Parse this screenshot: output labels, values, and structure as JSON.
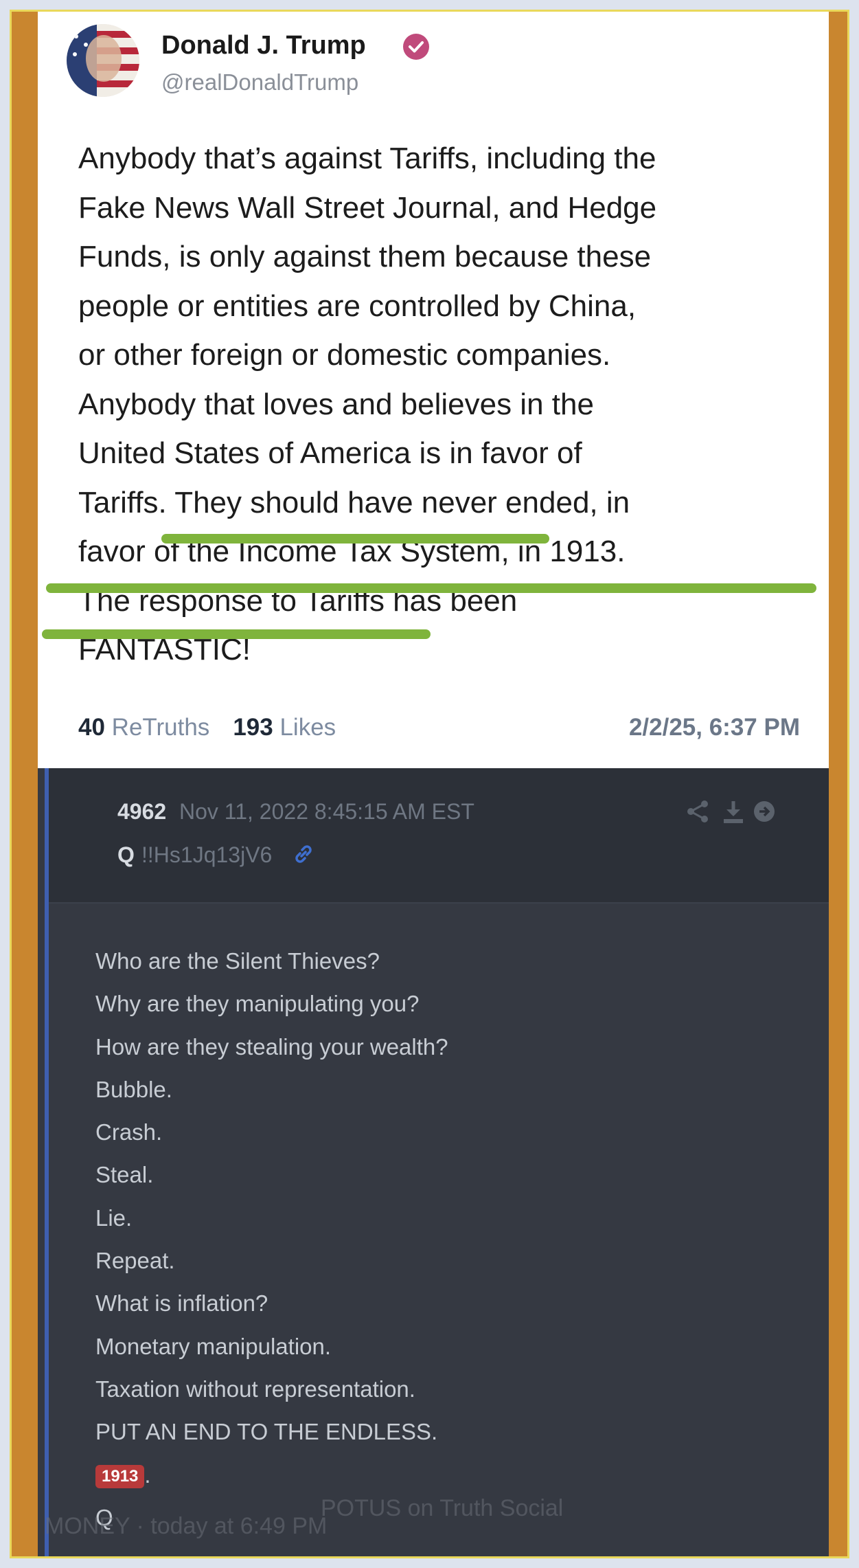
{
  "truth_post": {
    "author_name": "Donald J. Trump",
    "handle": "@realDonaldTrump",
    "body_lines": [
      "Anybody that’s against Tariffs, including the",
      "Fake News Wall Street Journal, and Hedge",
      "Funds, is only against them because these",
      "people or entities are controlled by China,",
      "or other foreign or domestic companies.",
      "Anybody that loves and believes in the",
      "United States of America is in favor of",
      "Tariffs. They should have never ended, in",
      "favor of the Income Tax System, in 1913.",
      "The response to Tariffs has been",
      "FANTASTIC!"
    ],
    "retruths_count": "40",
    "retruths_label": "ReTruths",
    "likes_count": "193",
    "likes_label": "Likes",
    "timestamp": "2/2/25, 6:37 PM",
    "highlight_color": "#7fb43c"
  },
  "q_post": {
    "post_number": "4962",
    "date": "Nov 11, 2022 8:45:15 AM EST",
    "poster": "Q",
    "tripcode": "!!Hs1Jq13jV6",
    "lines": [
      "Who are the Silent Thieves?",
      "Why are they manipulating you?",
      "How are they stealing your wealth?",
      "Bubble.",
      "Crash.",
      "Steal.",
      "Lie.",
      "Repeat.",
      "What is inflation?",
      "Monetary manipulation.",
      "Taxation without representation.",
      "PUT AN END TO THE ENDLESS."
    ],
    "tag": "1913",
    "tag_suffix": ".",
    "signature": "Q",
    "icons": [
      "share-icon",
      "download-icon",
      "arrow-right-icon",
      "link-icon"
    ]
  },
  "overlay": {
    "left_text": "MONEY · today at 6:49 PM",
    "right_text": "POTUS on Truth Social"
  }
}
